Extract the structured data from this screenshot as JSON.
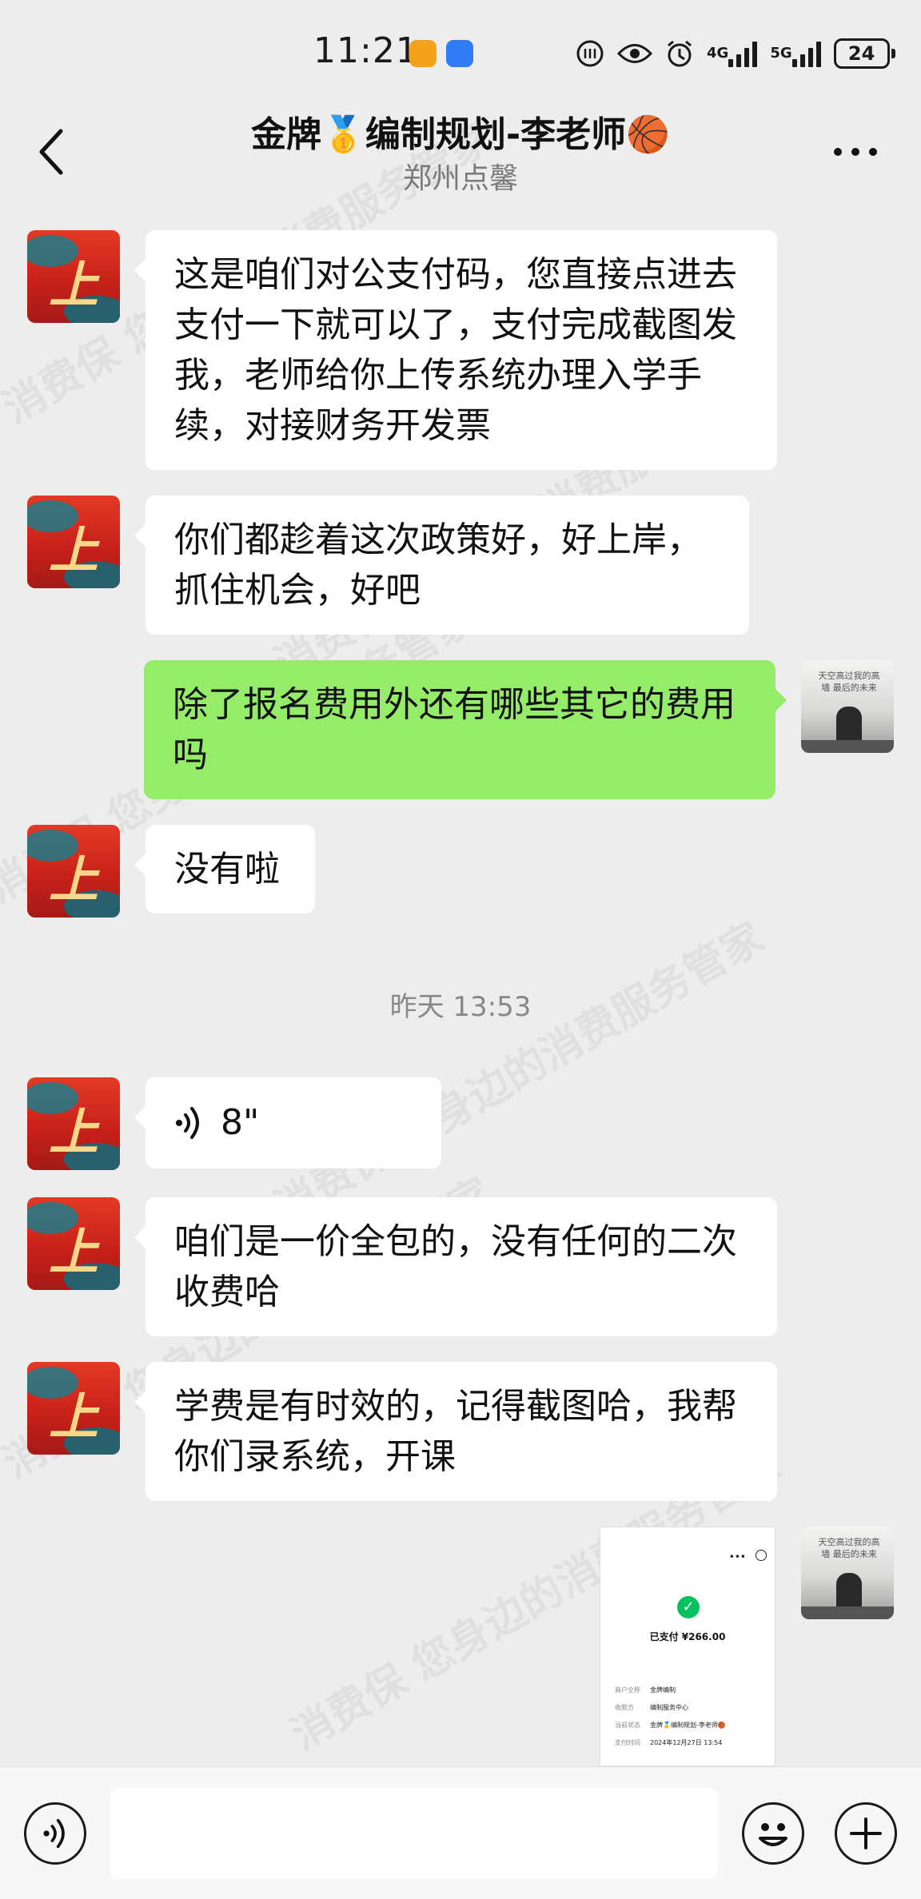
{
  "status_bar": {
    "time": "11:21",
    "net_4g": "4G",
    "net_5g": "5G",
    "battery": "24"
  },
  "nav": {
    "title": "金牌🥇编制规划-李老师🏀",
    "subtitle": "郑州点馨"
  },
  "messages": [
    {
      "side": "in",
      "text": "这是咱们对公支付码，您直接点进去支付一下就可以了，支付完成截图发我，老师给你上传系统办理入学手续，对接财务开发票"
    },
    {
      "side": "in",
      "text": "你们都趁着这次政策好，好上岸，抓住机会，好吧"
    },
    {
      "side": "out",
      "text": "除了报名费用外还有哪些其它的费用吗"
    },
    {
      "side": "in",
      "text": "没有啦"
    },
    {
      "side": "in",
      "type": "voice",
      "text": "8\""
    },
    {
      "side": "in",
      "text": "咱们是一价全包的，没有任何的二次收费哈"
    },
    {
      "side": "in",
      "text": "学费是有时效的，记得截图哈，我帮你们录系统，开课"
    }
  ],
  "timestamp": "昨天 13:53",
  "avatars": {
    "left_glyph": "上岸",
    "right_text": "天空高过我的高墙 最后的未来"
  },
  "receipt": {
    "paid_text": "已支付 ¥266.00",
    "rows": [
      {
        "k": "商户全称",
        "v": "金牌编制"
      },
      {
        "k": "收款方",
        "v": "编制服务中心"
      },
      {
        "k": "当前状态",
        "v": "金牌🥇编制规划-李老师🏀"
      },
      {
        "k": "支付时间",
        "v": "2024年12月27日 13:54"
      }
    ]
  },
  "watermark": "消费保 您身边的消费服务管家",
  "colors": {
    "background": "#ededed",
    "bubble_in": "#ffffff",
    "bubble_out": "#95ec69",
    "check": "#07c160"
  }
}
